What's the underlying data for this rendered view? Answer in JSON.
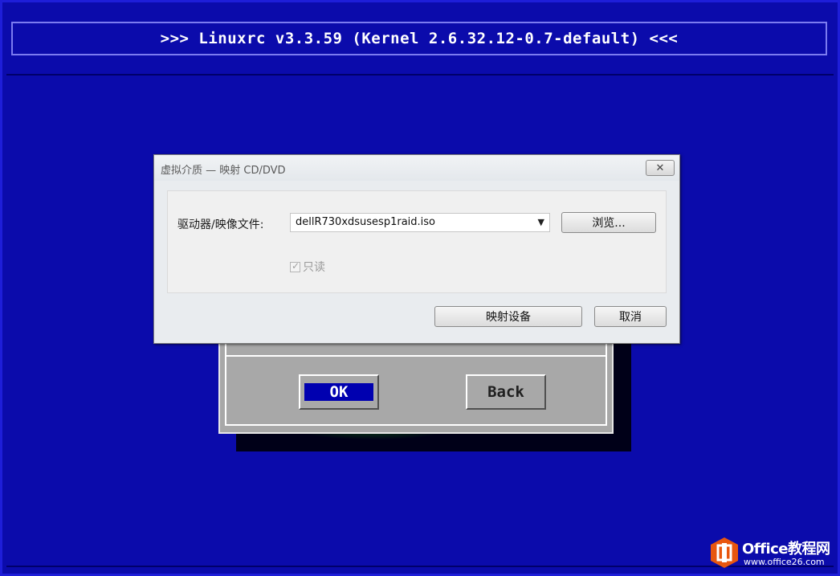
{
  "console": {
    "title": ">>> Linuxrc v3.3.59 (Kernel 2.6.32.12-0.7-default) <<<",
    "ok_label": "OK",
    "back_label": "Back"
  },
  "dialog": {
    "title": "虚拟介质 — 映射 CD/DVD",
    "close_glyph": "✕",
    "drive_label": "驱动器/映像文件:",
    "image_file_value": "dellR730xdsusesp1raid.iso",
    "dropdown_glyph": "▼",
    "browse_label": "浏览...",
    "readonly_label": "只读",
    "readonly_checked": true,
    "check_glyph": "✓",
    "map_device_label": "映射设备",
    "cancel_label": "取消"
  },
  "watermark": {
    "brand": "Office教程网",
    "url": "www.office26.com",
    "color": "#e8560f",
    "icon": "office-logo-icon"
  },
  "colors": {
    "console_bg": "#0b0bab",
    "dialog_bg": "#e9ecef",
    "tm_dialog_bg": "#a8a8a8",
    "ok_highlight": "#0000b0"
  }
}
